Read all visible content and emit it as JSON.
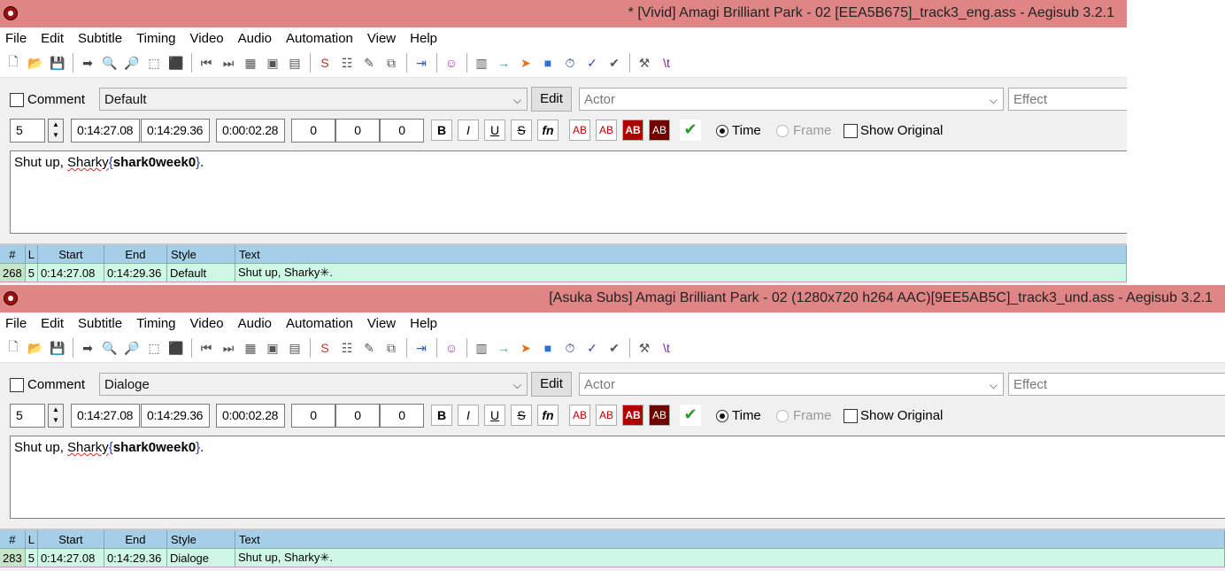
{
  "windows": [
    {
      "title": "* [Vivid] Amagi Brilliant Park - 02 [EEA5B675]_track3_eng.ass - Aegisub 3.2.1",
      "menu": [
        "File",
        "Edit",
        "Subtitle",
        "Timing",
        "Video",
        "Audio",
        "Automation",
        "View",
        "Help"
      ],
      "comment_label": "Comment",
      "style": "Default",
      "edit_label": "Edit",
      "actor_placeholder": "Actor",
      "effect_placeholder": "Effect",
      "layer": "5",
      "start": "0:14:27.08",
      "end": "0:14:29.36",
      "duration": "0:00:02.28",
      "margin_l": "0",
      "margin_r": "0",
      "margin_v": "0",
      "time_label": "Time",
      "frame_label": "Frame",
      "show_original_label": "Show Original",
      "text_plain": "Shut up, ",
      "text_squiggle": "Sharky",
      "text_tag_open": "{",
      "text_tag": "shark0week0",
      "text_tag_close": "}",
      "text_end": ".",
      "grid_headers": [
        "#",
        "L",
        "Start",
        "End",
        "Style",
        "Text"
      ],
      "grid_row": [
        "268",
        "5",
        "0:14:27.08",
        "0:14:29.36",
        "Default",
        "Shut up, Sharky✳."
      ]
    },
    {
      "title": "[Asuka Subs] Amagi Brilliant Park - 02 (1280x720 h264 AAC)[9EE5AB5C]_track3_und.ass - Aegisub 3.2.1",
      "menu": [
        "File",
        "Edit",
        "Subtitle",
        "Timing",
        "Video",
        "Audio",
        "Automation",
        "View",
        "Help"
      ],
      "comment_label": "Comment",
      "style": "Dialoge",
      "edit_label": "Edit",
      "actor_placeholder": "Actor",
      "effect_placeholder": "Effect",
      "layer": "5",
      "start": "0:14:27.08",
      "end": "0:14:29.36",
      "duration": "0:00:02.28",
      "margin_l": "0",
      "margin_r": "0",
      "margin_v": "0",
      "time_label": "Time",
      "frame_label": "Frame",
      "show_original_label": "Show Original",
      "text_plain": "Shut up, ",
      "text_squiggle": "Sharky",
      "text_tag_open": "{",
      "text_tag": "shark0week0",
      "text_tag_close": "}",
      "text_end": ".",
      "grid_headers": [
        "#",
        "L",
        "Start",
        "End",
        "Style",
        "Text"
      ],
      "grid_row": [
        "283",
        "5",
        "0:14:27.08",
        "0:14:29.36",
        "Dialoge",
        "Shut up, Sharky✳."
      ]
    }
  ],
  "format_buttons": [
    "B",
    "I",
    "U",
    "S",
    "fn",
    "AB",
    "AB",
    "AB",
    "AB"
  ],
  "colors": {
    "titlebar": "#e08585",
    "grid_header": "#a5cfe6",
    "grid_row": "#d0f7e6"
  },
  "toolbar_icons": [
    "new-file-icon",
    "open-file-icon",
    "save-icon",
    "|",
    "jump-to-icon",
    "zoom-in-icon",
    "zoom-out-icon",
    "snap-start-icon",
    "snap-end-icon",
    "|",
    "video-start-icon",
    "video-end-icon",
    "properties-icon",
    "resolution-icon",
    "attachments-icon",
    "|",
    "styles-icon",
    "styles-manager-icon",
    "translation-icon",
    "resample-icon",
    "|",
    "shift-times-icon",
    "|",
    "kanji-timer-icon",
    "|",
    "timing-postprocess-icon",
    "audio-arrow-icon",
    "lead-in-icon",
    "stop-icon",
    "timer-icon",
    "spell-check-icon",
    "assistant-icon",
    "|",
    "options-icon",
    "tag-toggle-icon"
  ]
}
